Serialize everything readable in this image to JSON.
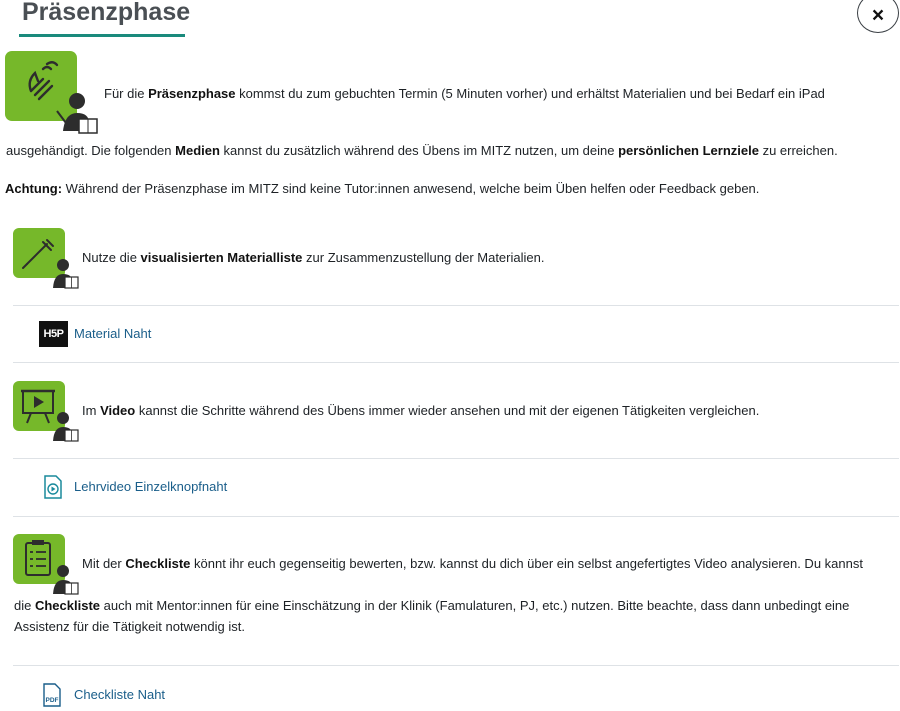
{
  "header": {
    "title": "Präsenzphase",
    "close_label": "×"
  },
  "intro": {
    "p1_a": "Für die ",
    "p1_b": "Präsenzphase",
    "p1_c": " kommst du zum gebuchten Termin (5 Minuten vorher) und erhältst Materialien und bei Bedarf ein iPad",
    "p2_a": "ausgehändigt. Die folgenden ",
    "p2_b": "Medien",
    "p2_c": " kannst du zusätzlich während des Übens im MITZ nutzen, um deine ",
    "p2_d": "persönlichen Lernziele",
    "p2_e": " zu erreichen.",
    "warn_a": "Achtung:",
    "warn_b": " Während der Präsenzphase im MITZ sind keine Tutor:innen anwesend, welche beim Üben helfen oder Feedback geben."
  },
  "section_material": {
    "text_a": "Nutze die ",
    "text_b": "visualisierten Materialliste",
    "text_c": " zur Zusammenzustellung der Materialien.",
    "link_label": "Material Naht",
    "badge": "H5P"
  },
  "section_video": {
    "text_a": "Im ",
    "text_b": "Video",
    "text_c": " kannst die Schritte während des Übens immer wieder ansehen und mit der eigenen Tätigkeiten vergleichen.",
    "link_label": "Lehrvideo Einzelknopfnaht"
  },
  "section_checklist": {
    "l1_a": "Mit der ",
    "l1_b": "Checkliste",
    "l1_c": " könnt ihr euch gegenseitig bewerten, bzw. kannst du dich über ein selbst angefertigtes Video analysieren. Du kannst",
    "l2_a": "die ",
    "l2_b": "Checkliste",
    "l2_c": " auch mit Mentor:innen für eine Einschätzung in der Klinik (Famulaturen, PJ, etc.) nutzen. Bitte beachte, dass dann unbedingt eine",
    "l3": "Assistenz für die Tätigkeit notwendig ist.",
    "link_label": "Checkliste Naht",
    "pdf_label": "PDF"
  },
  "colors": {
    "accent_green": "#76b82a",
    "link_blue": "#1a5e8a",
    "teal_underline": "#1a8a7c"
  }
}
